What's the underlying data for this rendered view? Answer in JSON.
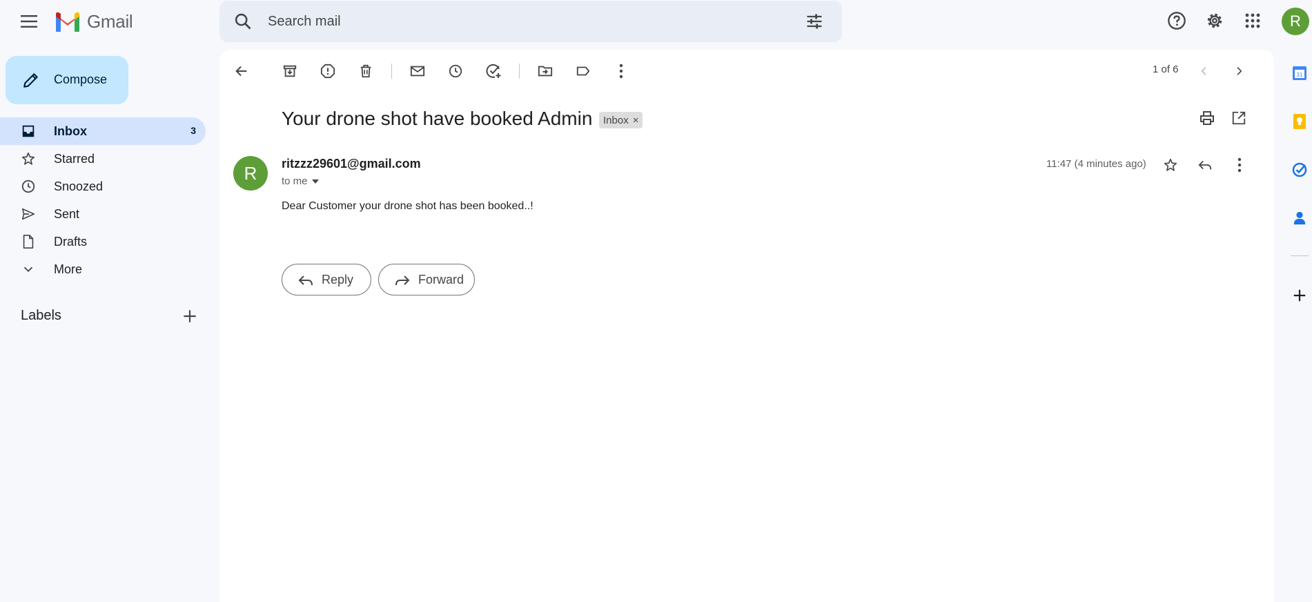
{
  "header": {
    "app_name": "Gmail",
    "search_placeholder": "Search mail",
    "account_initial": "R"
  },
  "sidebar": {
    "compose_label": "Compose",
    "items": [
      {
        "label": "Inbox",
        "count": "3",
        "icon": "inbox-icon"
      },
      {
        "label": "Starred",
        "count": "",
        "icon": "star-icon"
      },
      {
        "label": "Snoozed",
        "count": "",
        "icon": "clock-icon"
      },
      {
        "label": "Sent",
        "count": "",
        "icon": "send-icon"
      },
      {
        "label": "Drafts",
        "count": "",
        "icon": "draft-icon"
      },
      {
        "label": "More",
        "count": "",
        "icon": "chevron-down-icon"
      }
    ],
    "labels_title": "Labels"
  },
  "toolbar": {
    "pager": "1 of 6"
  },
  "message": {
    "subject": "Your drone shot have booked Admin",
    "label_chip": "Inbox",
    "label_chip_close": "×",
    "sender_initial": "R",
    "sender_email": "ritzzz29601@gmail.com",
    "recipient": "to me",
    "time": "11:47 (4 minutes ago)",
    "body": "Dear Customer your drone shot has been booked..!",
    "reply_label": "Reply",
    "forward_label": "Forward"
  },
  "colors": {
    "accent": "#c2e7ff",
    "active_nav": "#d3e3fd",
    "avatar": "#5e9e38",
    "background": "#f6f8fc"
  }
}
